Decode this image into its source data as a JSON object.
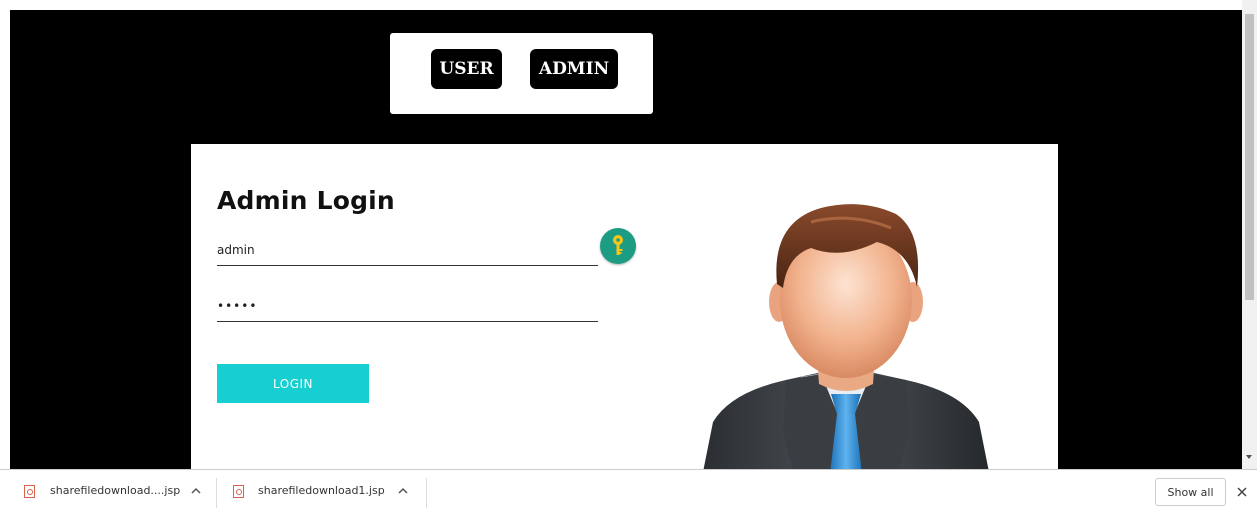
{
  "nav": {
    "user_label": "USER",
    "admin_label": "ADMIN"
  },
  "login": {
    "title": "Admin Login",
    "username_value": "admin",
    "password_value": "admin",
    "button_label": "LOGIN"
  },
  "downloads": {
    "items": [
      {
        "name": "sharefiledownload....jsp"
      },
      {
        "name": "sharefiledownload1.jsp"
      }
    ],
    "show_all_label": "Show all"
  },
  "colors": {
    "page_background": "#000000",
    "accent_button": "#17cfd1",
    "key_icon_background": "#1c9c82"
  },
  "icons": [
    "key-icon",
    "user-avatar-icon",
    "file-icon",
    "chevron-up-icon",
    "close-icon"
  ]
}
